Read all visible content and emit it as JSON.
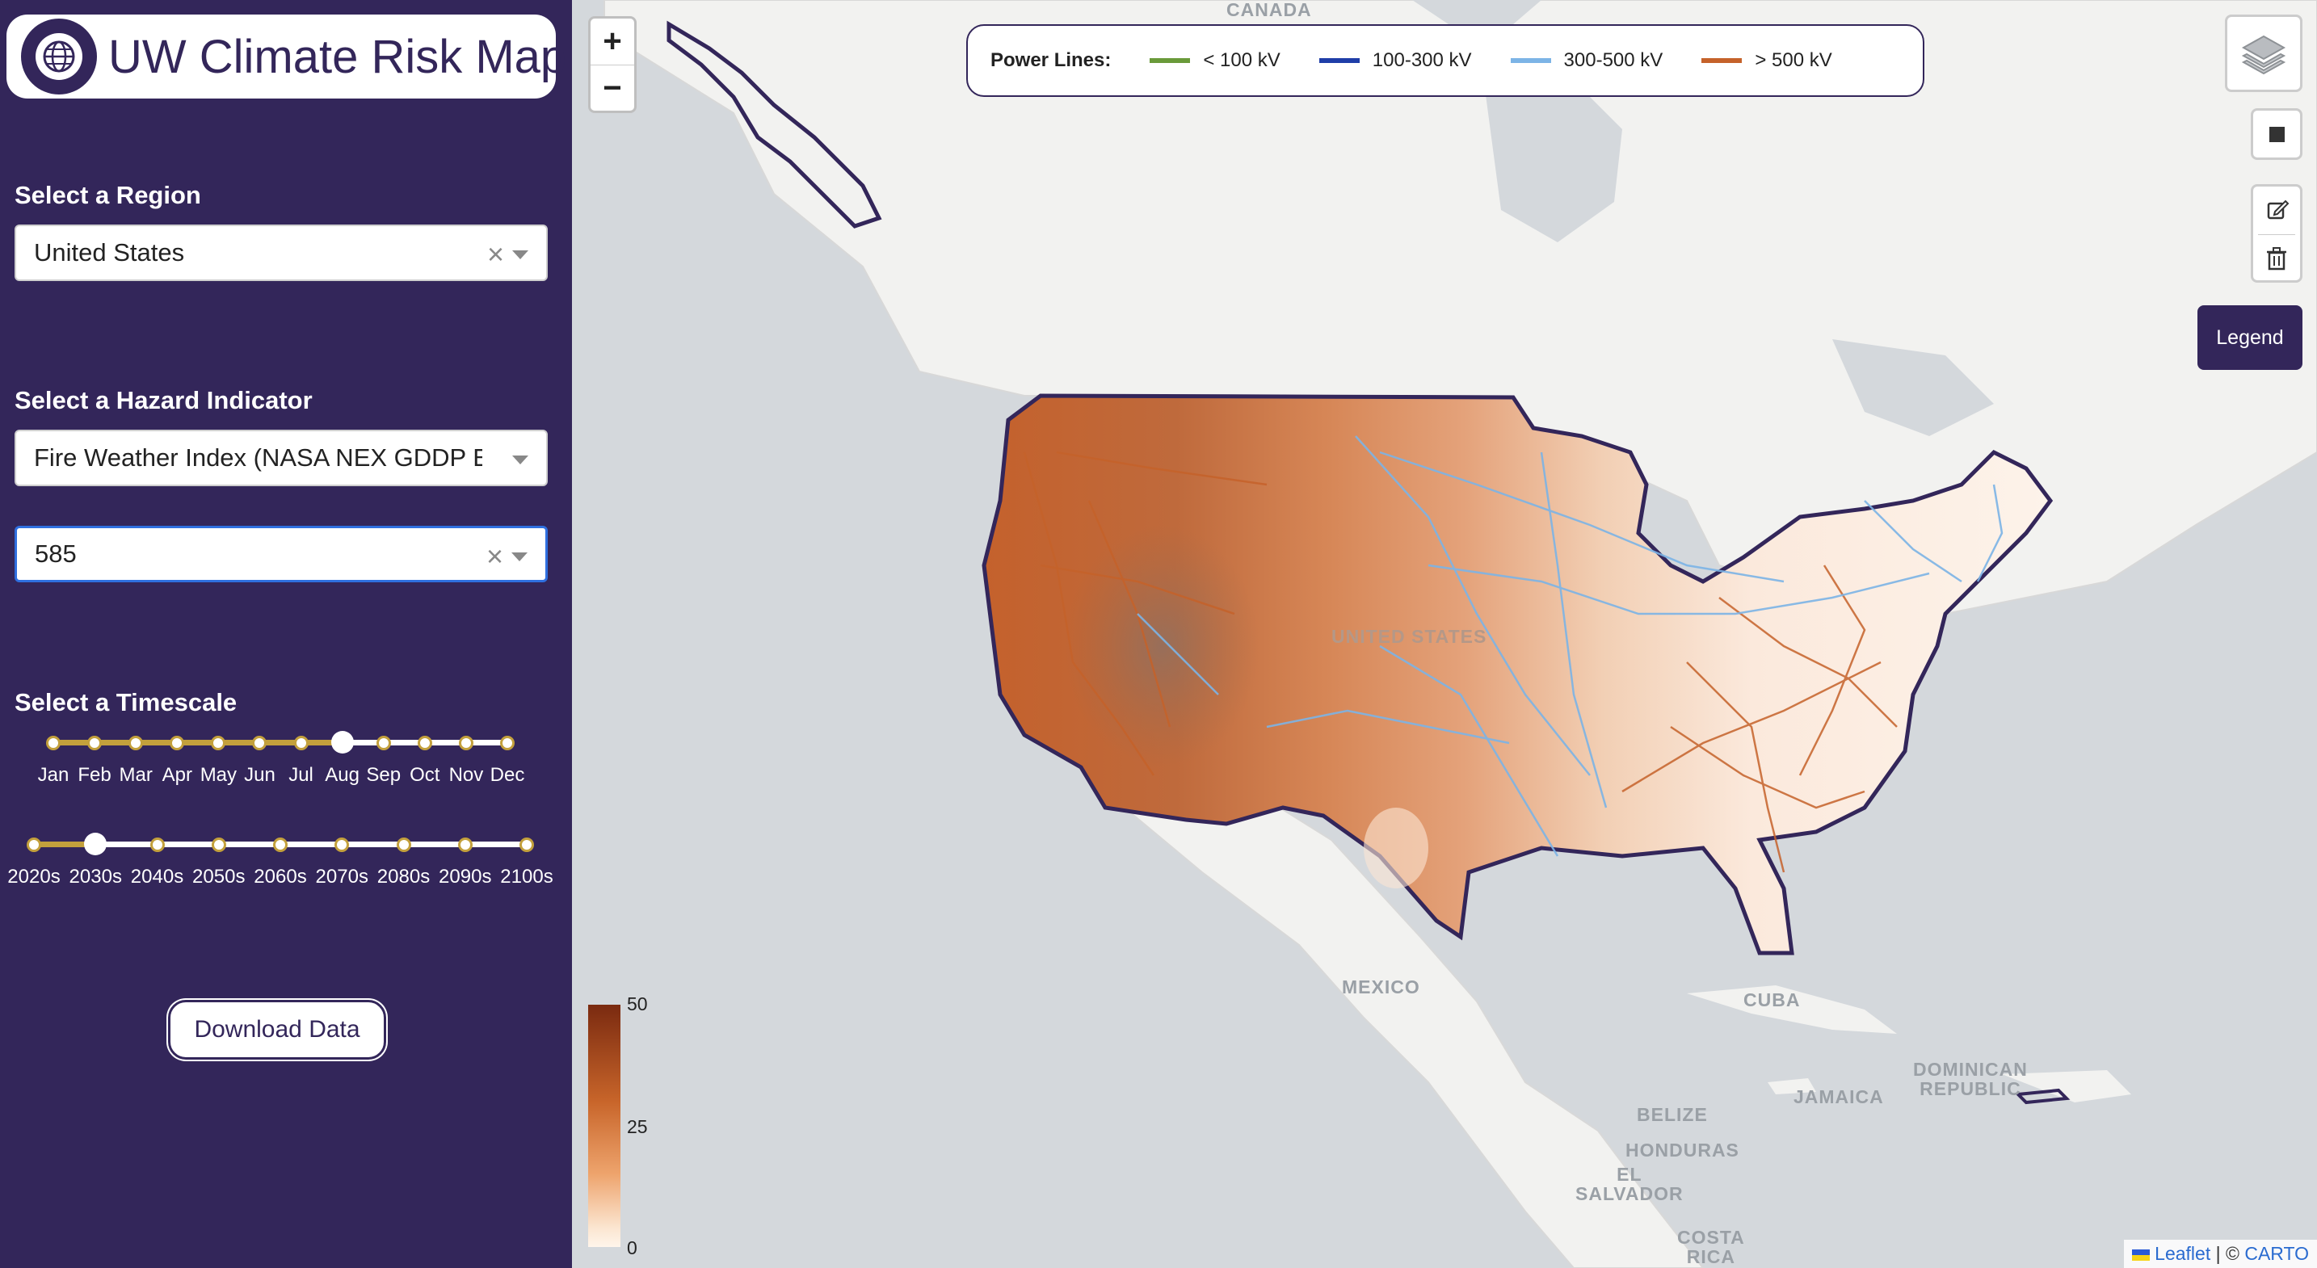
{
  "app": {
    "title": "UW Climate Risk Map"
  },
  "region": {
    "label": "Select a Region",
    "value": "United States"
  },
  "hazard": {
    "label": "Select a Hazard Indicator",
    "value": "Fire Weather Index (NASA NEX GDDP En...",
    "scenario_value": "585"
  },
  "timescale": {
    "label": "Select a Timescale",
    "months": [
      "Jan",
      "Feb",
      "Mar",
      "Apr",
      "May",
      "Jun",
      "Jul",
      "Aug",
      "Sep",
      "Oct",
      "Nov",
      "Dec"
    ],
    "selected_month": "Aug",
    "decades": [
      "2020s",
      "2030s",
      "2040s",
      "2050s",
      "2060s",
      "2070s",
      "2080s",
      "2090s",
      "2100s"
    ],
    "selected_decade": "2030s"
  },
  "download": {
    "label": "Download Data"
  },
  "map": {
    "zoom_in": "+",
    "zoom_out": "−",
    "power_lines": {
      "title": "Power Lines:",
      "items": [
        {
          "label": "< 100 kV",
          "color": "#6a9a3a"
        },
        {
          "label": "100-300 kV",
          "color": "#1f3ea8"
        },
        {
          "label": "300-500 kV",
          "color": "#7cb4e6"
        },
        {
          "label": "> 500 kV",
          "color": "#c5622a"
        }
      ]
    },
    "legend_button": "Legend",
    "colorbar": {
      "max": "50",
      "mid": "25",
      "min": "0"
    },
    "place_labels": {
      "canada": "CANADA",
      "united_states": "UNITED STATES",
      "mexico": "MEXICO",
      "cuba": "CUBA",
      "dominican": "DOMINICAN\nREPUBLIC",
      "jamaica": "JAMAICA",
      "belize": "BELIZE",
      "honduras": "HONDURAS",
      "el_salvador": "EL\nSALVADOR",
      "costa_rica": "COSTA\nRICA"
    },
    "attribution": {
      "leaflet": "Leaflet",
      "sep": "| ©",
      "carto": "CARTO"
    }
  },
  "icons": [
    "layers-icon",
    "square-icon",
    "edit-icon",
    "trash-icon",
    "globe-icon"
  ]
}
